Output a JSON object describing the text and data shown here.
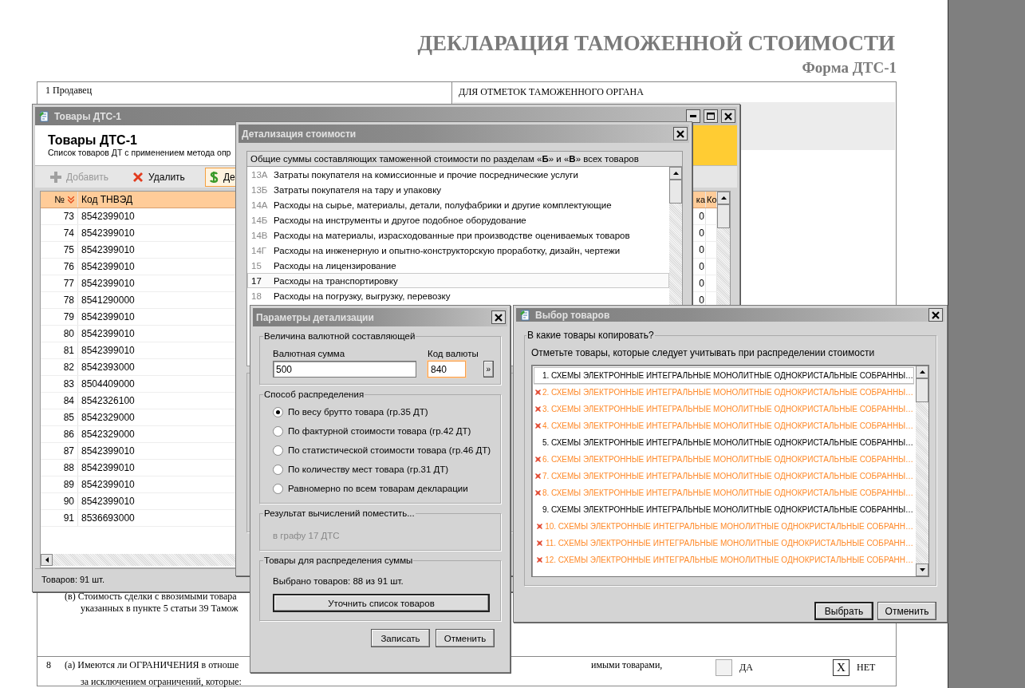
{
  "document": {
    "title": "ДЕКЛАРАЦИЯ ТАМОЖЕННОЙ СТОИМОСТИ",
    "form": "Форма ДТС-1",
    "seller_label": "1 Продавец",
    "customs_label": "ДЛЯ ОТМЕТОК ТАМОЖЕННОГО ОРГАНА",
    "item_v": [
      "(в) Стоимость сделки с ввозимыми товара",
      "указанных в пункте 5 статьи 39 Тамож"
    ],
    "item_8": {
      "number": "8",
      "line_1": "(а) Имеются ли ОГРАНИЧЕНИЯ в отноше",
      "line_1_end": "имыми товарами,",
      "line_2": "за исключением ограничений, которые:",
      "options": [
        {
          "label": "ДА",
          "checked": false
        },
        {
          "label": "НЕТ",
          "checked": true,
          "mark": "X"
        }
      ]
    }
  },
  "goods_window": {
    "title": "Товары ДТС-1",
    "heading": "Товары ДТС-1",
    "subtitle": "Список товаров ДТ с применением метода опр",
    "toolbar": [
      {
        "label": "Добавить",
        "disabled": true,
        "selected": false
      },
      {
        "label": "Удалить",
        "disabled": false,
        "selected": false
      },
      {
        "label": "Де",
        "disabled": false,
        "selected": true
      }
    ],
    "columns": [
      "№",
      "Код ТНВЭД",
      "ка",
      "Ко"
    ],
    "rows": [
      {
        "number": "73",
        "code": "8542399010",
        "column_3": "0"
      },
      {
        "number": "74",
        "code": "8542399010",
        "column_3": "0"
      },
      {
        "number": "75",
        "code": "8542399010",
        "column_3": "0"
      },
      {
        "number": "76",
        "code": "8542399010",
        "column_3": "0"
      },
      {
        "number": "77",
        "code": "8542399010",
        "column_3": "0"
      },
      {
        "number": "78",
        "code": "8541290000",
        "column_3": "0"
      },
      {
        "number": "79",
        "code": "8542399010"
      },
      {
        "number": "80",
        "code": "8542399010"
      },
      {
        "number": "81",
        "code": "8542399010"
      },
      {
        "number": "82",
        "code": "8542393000"
      },
      {
        "number": "83",
        "code": "8504409000"
      },
      {
        "number": "84",
        "code": "8542326100"
      },
      {
        "number": "85",
        "code": "8542329000"
      },
      {
        "number": "86",
        "code": "8542329000"
      },
      {
        "number": "87",
        "code": "8542399010"
      },
      {
        "number": "88",
        "code": "8542399010"
      },
      {
        "number": "89",
        "code": "8542399010"
      },
      {
        "number": "90",
        "code": "8542399010"
      },
      {
        "number": "91",
        "code": "8536693000"
      }
    ],
    "status": "Товаров: 91 шт."
  },
  "detail_window": {
    "title": "Детализация стоимости",
    "caption": "Общие суммы составляющих таможенной стоимости по разделам «**Б**» и «**В**» всех товаров",
    "items": [
      {
        "code": "13А",
        "label": "Затраты покупателя на комиссионные и прочие посреднические услуги",
        "selected": false
      },
      {
        "code": "13Б",
        "label": "Затраты покупателя на тару и упаковку",
        "selected": false
      },
      {
        "code": "14А",
        "label": "Расходы на сырье, материалы, детали, полуфабрики и другие комплектующие",
        "selected": false
      },
      {
        "code": "14Б",
        "label": "Расходы на инструменты и другое подобное оборудование",
        "selected": false
      },
      {
        "code": "14В",
        "label": "Расходы на материалы, израсходованные при производстве оцениваемых товаров",
        "selected": false
      },
      {
        "code": "14Г",
        "label": "Расходы на инженерную и опытно-конструкторскую проработку, дизайн, чертежи",
        "selected": false
      },
      {
        "code": "15",
        "label": "Расходы на лицензирование",
        "selected": false
      },
      {
        "code": "17",
        "label": "Расходы на транспортировку",
        "selected": true
      },
      {
        "code": "18",
        "label": "Расходы на погрузку, выгрузку, перевозку",
        "selected": false
      }
    ]
  },
  "params_window": {
    "title": "Параметры детализации",
    "currency_group": "Величина валютной составляющей",
    "amount_label": "Валютная сумма",
    "amount": "500",
    "code_label": "Код валюты",
    "code": "840",
    "picker": "»",
    "method_group": "Способ распределения",
    "methods": [
      {
        "label": "По весу брутто товара (гр.35 ДТ)",
        "selected": true
      },
      {
        "label": "По фактурной стоимости товара (гр.42 ДТ)",
        "selected": false
      },
      {
        "label": "По статистической стоимости товара (гр.46 ДТ)",
        "selected": false
      },
      {
        "label": "По количеству мест товара (гр.31 ДТ)",
        "selected": false
      },
      {
        "label": "Равномерно по всем товарам декларации",
        "selected": false
      }
    ],
    "result_group": "Результат вычислений поместить...",
    "result": {
      "text": "в графу 17 ДТС",
      "disabled": true
    },
    "goods_group": "Товары для распределения суммы",
    "goods_count": "Выбрано товаров: 88 из 91 шт.",
    "refine_button": "Уточнить список товаров",
    "buttons": [
      "Записать",
      "Отменить"
    ]
  },
  "select_window": {
    "title": "Выбор товаров",
    "group": "В какие товары копировать?",
    "hint": "Отметьте товары, которые следует учитывать при распределении стоимости",
    "items": [
      {
        "label": "1. СХЕМЫ ЭЛЕКТРОННЫЕ ИНТЕГРАЛЬНЫЕ МОНОЛИТНЫЕ ОДНОКРИСТАЛЬНЫЕ СОБРАННЫ…",
        "checked": false,
        "selected": true
      },
      {
        "label": "2. СХЕМЫ ЭЛЕКТРОННЫЕ ИНТЕГРАЛЬНЫЕ МОНОЛИТНЫЕ ОДНОКРИСТАЛЬНЫЕ СОБРАННЫ…",
        "checked": true,
        "selected": false
      },
      {
        "label": "3. СХЕМЫ ЭЛЕКТРОННЫЕ ИНТЕГРАЛЬНЫЕ МОНОЛИТНЫЕ ОДНОКРИСТАЛЬНЫЕ СОБРАННЫ…",
        "checked": true,
        "selected": false
      },
      {
        "label": "4. СХЕМЫ ЭЛЕКТРОННЫЕ ИНТЕГРАЛЬНЫЕ МОНОЛИТНЫЕ ОДНОКРИСТАЛЬНЫЕ СОБРАННЫ…",
        "checked": true,
        "selected": false
      },
      {
        "label": "5. СХЕМЫ ЭЛЕКТРОННЫЕ ИНТЕГРАЛЬНЫЕ МОНОЛИТНЫЕ ОДНОКРИСТАЛЬНЫЕ СОБРАННЫ…",
        "checked": false,
        "selected": false
      },
      {
        "label": "6. СХЕМЫ ЭЛЕКТРОННЫЕ ИНТЕГРАЛЬНЫЕ МОНОЛИТНЫЕ ОДНОКРИСТАЛЬНЫЕ СОБРАННЫ…",
        "checked": true,
        "selected": false
      },
      {
        "label": "7. СХЕМЫ ЭЛЕКТРОННЫЕ ИНТЕГРАЛЬНЫЕ МОНОЛИТНЫЕ ОДНОКРИСТАЛЬНЫЕ СОБРАННЫ…",
        "checked": true,
        "selected": false
      },
      {
        "label": "8. СХЕМЫ ЭЛЕКТРОННЫЕ ИНТЕГРАЛЬНЫЕ МОНОЛИТНЫЕ ОДНОКРИСТАЛЬНЫЕ СОБРАННЫ…",
        "checked": true,
        "selected": false
      },
      {
        "label": "9. СХЕМЫ ЭЛЕКТРОННЫЕ ИНТЕГРАЛЬНЫЕ МОНОЛИТНЫЕ ОДНОКРИСТАЛЬНЫЕ СОБРАННЫ…",
        "checked": false,
        "selected": false
      },
      {
        "label": "10. СХЕМЫ ЭЛЕКТРОННЫЕ ИНТЕГРАЛЬНЫЕ МОНОЛИТНЫЕ ОДНОКРИСТАЛЬНЫЕ СОБРАНН…",
        "checked": true,
        "selected": false
      },
      {
        "label": "11. СХЕМЫ ЭЛЕКТРОННЫЕ ИНТЕГРАЛЬНЫЕ МОНОЛИТНЫЕ ОДНОКРИСТАЛЬНЫЕ СОБРАНН…",
        "checked": true,
        "selected": false
      },
      {
        "label": "12. СХЕМЫ ЭЛЕКТРОННЫЕ ИНТЕГРАЛЬНЫЕ МОНОЛИТНЫЕ ОДНОКРИСТАЛЬНЫЕ СОБРАНН…",
        "checked": true,
        "selected": false
      }
    ],
    "buttons": [
      {
        "label": "Выбрать",
        "default": true
      },
      {
        "label": "Отменить",
        "default": false
      }
    ]
  }
}
